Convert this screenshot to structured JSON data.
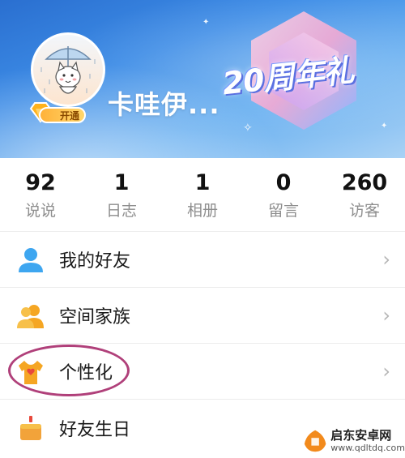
{
  "profile": {
    "nickname": "卡哇伊...",
    "open_badge": "开通",
    "anniversary_banner": "20周年礼"
  },
  "stats": [
    {
      "value": "92",
      "label": "说说"
    },
    {
      "value": "1",
      "label": "日志"
    },
    {
      "value": "1",
      "label": "相册"
    },
    {
      "value": "0",
      "label": "留言"
    },
    {
      "value": "260",
      "label": "访客"
    }
  ],
  "menu": [
    {
      "label": "我的好友",
      "icon": "friend-icon"
    },
    {
      "label": "空间家族",
      "icon": "family-icon"
    },
    {
      "label": "个性化",
      "icon": "tshirt-icon"
    },
    {
      "label": "好友生日",
      "icon": "cake-icon"
    }
  ],
  "watermark": {
    "title": "启东安卓网",
    "url": "www.qdltdq.com"
  },
  "colors": {
    "banner_blue": "#3d8ce6",
    "highlight": "#b0407a",
    "friend_icon": "#3ea6f0",
    "family_icon": "#f5a623",
    "cake_icon": "#f2a33a"
  }
}
